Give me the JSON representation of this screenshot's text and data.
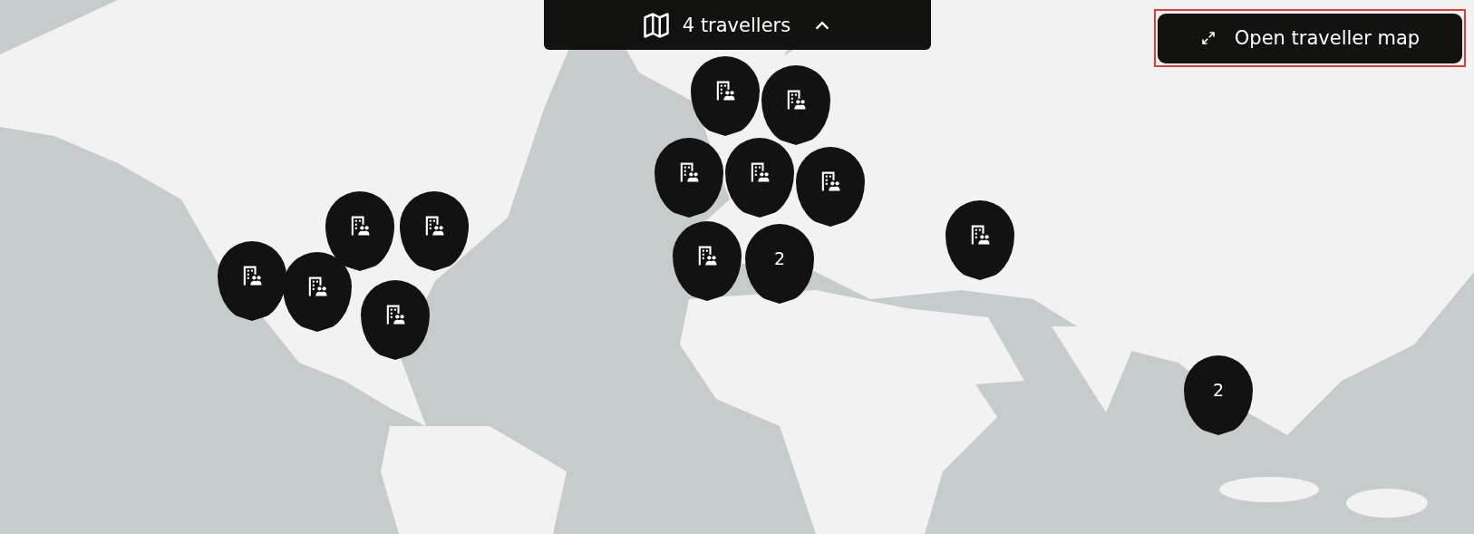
{
  "travellers_bar": {
    "label": "4 travellers"
  },
  "open_map_button": {
    "label": "Open traveller map"
  },
  "markers": [
    {
      "kind": "building"
    },
    {
      "kind": "building"
    },
    {
      "kind": "building"
    },
    {
      "kind": "building"
    },
    {
      "kind": "building"
    },
    {
      "kind": "building"
    },
    {
      "kind": "cluster",
      "count": "2"
    },
    {
      "kind": "building"
    },
    {
      "kind": "building"
    },
    {
      "kind": "building"
    },
    {
      "kind": "building"
    },
    {
      "kind": "building"
    },
    {
      "kind": "building"
    },
    {
      "kind": "cluster",
      "count": "2"
    }
  ]
}
